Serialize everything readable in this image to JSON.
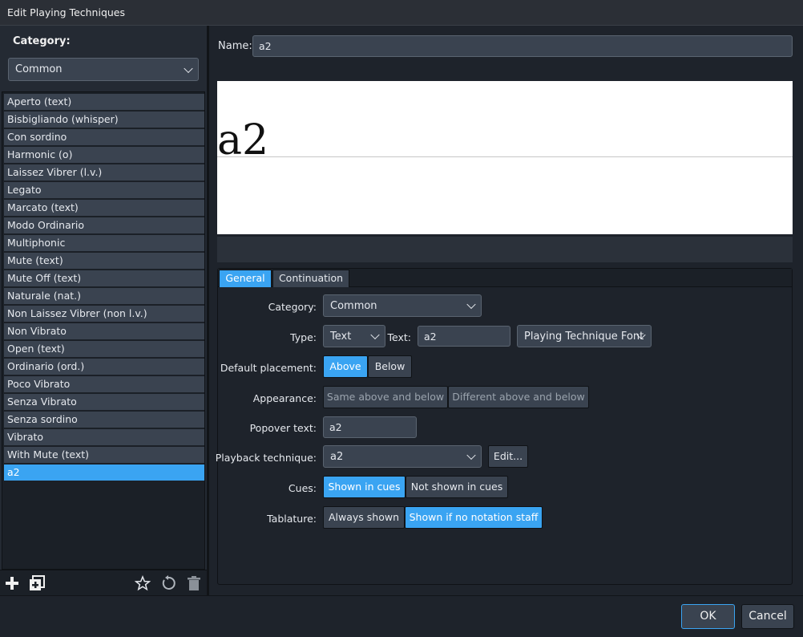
{
  "window": {
    "title": "Edit Playing Techniques"
  },
  "left": {
    "category_label": "Category:",
    "category_value": "Common",
    "items": [
      "Aperto (text)",
      "Bisbigliando (whisper)",
      "Con sordino",
      "Harmonic (o)",
      "Laissez Vibrer (l.v.)",
      "Legato",
      "Marcato (text)",
      "Modo Ordinario",
      "Multiphonic",
      "Mute (text)",
      "Mute Off (text)",
      "Naturale (nat.)",
      "Non Laissez Vibrer (non l.v.)",
      "Non Vibrato",
      "Open (text)",
      "Ordinario (ord.)",
      "Poco Vibrato",
      "Senza Vibrato",
      "Senza sordino",
      "Vibrato",
      "With Mute (text)",
      "a2"
    ],
    "selected_index": 21,
    "toolbar": {
      "add_icon": "plus-icon",
      "duplicate_icon": "duplicate-icon",
      "favorite_icon": "star-icon",
      "reset_icon": "reset-icon",
      "delete_icon": "trash-icon"
    }
  },
  "right": {
    "name_label": "Name:",
    "name_value": "a2",
    "preview_text": "a2",
    "tabs": [
      "General",
      "Continuation"
    ],
    "active_tab": "General",
    "form": {
      "category": {
        "label": "Category:",
        "value": "Common"
      },
      "type": {
        "label": "Type:",
        "value": "Text"
      },
      "text": {
        "label": "Text:",
        "value": "a2"
      },
      "font": {
        "value": "Playing Technique Font"
      },
      "placement": {
        "label": "Default placement:",
        "options": [
          "Above",
          "Below"
        ],
        "selected": "Above"
      },
      "appearance": {
        "label": "Appearance:",
        "options": [
          "Same above and below",
          "Different above and below"
        ]
      },
      "popover": {
        "label": "Popover text:",
        "value": "a2"
      },
      "playback": {
        "label": "Playback technique:",
        "value": "a2",
        "edit_label": "Edit..."
      },
      "cues": {
        "label": "Cues:",
        "options": [
          "Shown in cues",
          "Not shown in cues"
        ],
        "selected": "Shown in cues"
      },
      "tablature": {
        "label": "Tablature:",
        "options": [
          "Always shown",
          "Shown if no notation staff"
        ],
        "selected": "Shown if no notation staff"
      }
    }
  },
  "footer": {
    "ok_label": "OK",
    "cancel_label": "Cancel"
  },
  "colors": {
    "accent": "#3aa4f2",
    "panel": "#242a33",
    "field": "#3a4350"
  }
}
